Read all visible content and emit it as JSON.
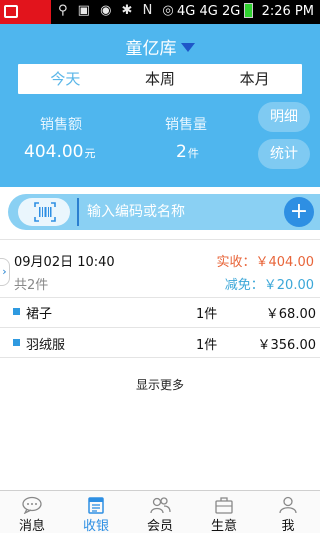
{
  "status_bar": {
    "network_4g_a": "4G",
    "network_4g_b": "4G",
    "network_2g": "2G",
    "time": "2:26 PM"
  },
  "header": {
    "store_name": "童亿库",
    "tabs": [
      {
        "label": "今天",
        "active": true
      },
      {
        "label": "本周",
        "active": false
      },
      {
        "label": "本月",
        "active": false
      }
    ],
    "sales_amount_label": "销售额",
    "sales_amount_value": "404.00",
    "sales_amount_unit": "元",
    "sales_volume_label": "销售量",
    "sales_volume_value": "2",
    "sales_volume_unit": "件",
    "detail_button": "明细",
    "stats_button": "统计"
  },
  "search": {
    "placeholder": "输入编码或名称"
  },
  "order": {
    "datetime": "09月02日 10:40",
    "count": "共2件",
    "paid": "实收：￥404.00",
    "discount": "减免：￥20.00",
    "items": [
      {
        "name": "裙子",
        "qty": "1件",
        "price": "￥68.00"
      },
      {
        "name": "羽绒服",
        "qty": "1件",
        "price": "￥356.00"
      }
    ]
  },
  "show_more": "显示更多",
  "bottom_nav": [
    {
      "label": "消息",
      "icon": "chat-icon"
    },
    {
      "label": "收银",
      "icon": "cashier-icon",
      "active": true
    },
    {
      "label": "会员",
      "icon": "members-icon"
    },
    {
      "label": "生意",
      "icon": "business-icon"
    },
    {
      "label": "我",
      "icon": "profile-icon"
    }
  ],
  "colors": {
    "header_bg": "#4fb6ee",
    "accent": "#2e8fe3",
    "paid_text": "#e8653a",
    "discount_text": "#3ba7d8"
  }
}
